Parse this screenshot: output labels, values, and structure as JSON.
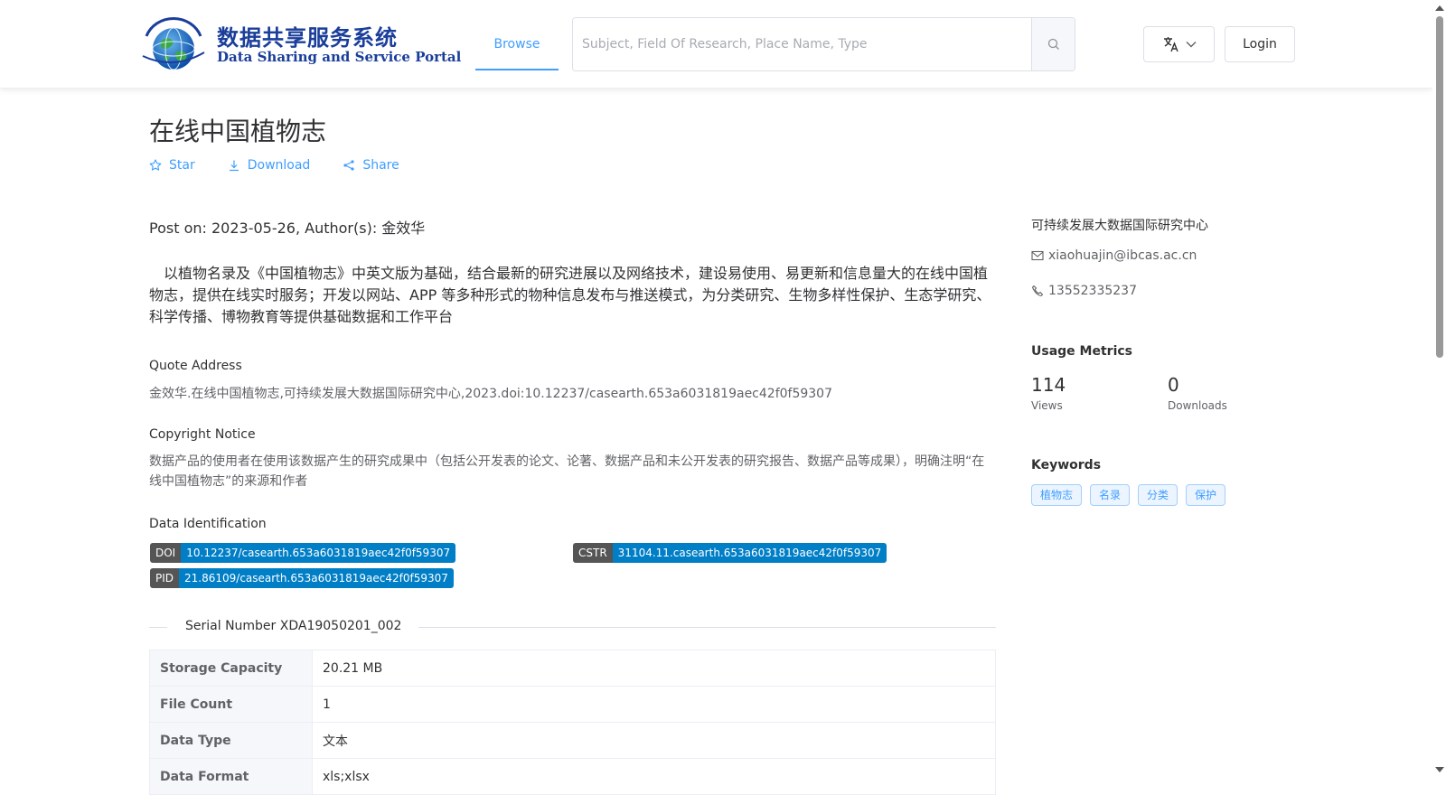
{
  "header": {
    "logo_cn": "数据共享服务系统",
    "logo_en": "Data Sharing and Service Portal",
    "nav_browse": "Browse",
    "search_placeholder": "Subject, Field Of Research, Place Name, Type",
    "login_label": "Login"
  },
  "dataset": {
    "title": "在线中国植物志",
    "actions": {
      "star": "Star",
      "download": "Download",
      "share": "Share"
    },
    "post_on": "Post on: 2023-05-26, Author(s): 金效华",
    "abstract": "以植物名录及《中国植物志》中英文版为基础，结合最新的研究进展以及网络技术，建设易使用、易更新和信息量大的在线中国植物志，提供在线实时服务；开发以网站、APP 等多种形式的物种信息发布与推送模式，为分类研究、生物多样性保护、生态学研究、科学传播、博物教育等提供基础数据和工作平台",
    "quote_label": "Quote Address",
    "quote_text": "金效华.在线中国植物志,可持续发展大数据国际研究中心,2023.doi:10.12237/casearth.653a6031819aec42f0f59307",
    "copyright_label": "Copyright Notice",
    "copyright_text": "数据产品的使用者在使用该数据产生的研究成果中（包括公开发表的论文、论著、数据产品和未公开发表的研究报告、数据产品等成果），明确注明“在线中国植物志”的来源和作者",
    "ident_label": "Data Identification",
    "identifiers": {
      "doi": {
        "key": "DOI",
        "value": "10.12237/casearth.653a6031819aec42f0f59307"
      },
      "cstr": {
        "key": "CSTR",
        "value": "31104.11.casearth.653a6031819aec42f0f59307"
      },
      "pid": {
        "key": "PID",
        "value": "21.86109/casearth.653a6031819aec42f0f59307"
      }
    },
    "serial_number": "Serial Number XDA19050201_002",
    "details": [
      {
        "key": "Storage Capacity",
        "value": "20.21 MB"
      },
      {
        "key": "File Count",
        "value": "1"
      },
      {
        "key": "Data Type",
        "value": "文本"
      },
      {
        "key": "Data Format",
        "value": "xls;xlsx"
      }
    ]
  },
  "sidebar": {
    "org": "可持续发展大数据国际研究中心",
    "email": "xiaohuajin@ibcas.ac.cn",
    "phone": "13552335237",
    "usage_heading": "Usage Metrics",
    "views_count": "114",
    "views_label": "Views",
    "downloads_count": "0",
    "downloads_label": "Downloads",
    "keywords_heading": "Keywords",
    "keywords": [
      "植物志",
      "名录",
      "分类",
      "保护"
    ]
  },
  "colors": {
    "accent": "#409eff",
    "badge_key": "#555555",
    "badge_value": "#007ec6"
  }
}
